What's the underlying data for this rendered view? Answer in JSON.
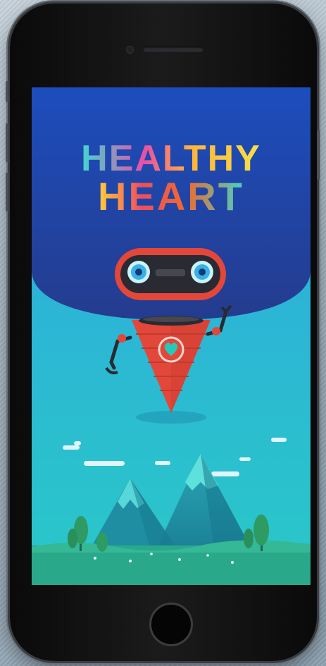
{
  "app": {
    "title_line1": "HEALTHY",
    "title_line2": "HEART"
  },
  "colors": {
    "sky_top": "#1f4fae",
    "sky_bottom": "#28c6cf",
    "robot_red": "#e2473a",
    "heart": "#26c9b8",
    "grass": "#2aa98a"
  },
  "icons": {
    "robot": "robot-mascot",
    "heart": "heart-icon",
    "home": "home-button"
  }
}
